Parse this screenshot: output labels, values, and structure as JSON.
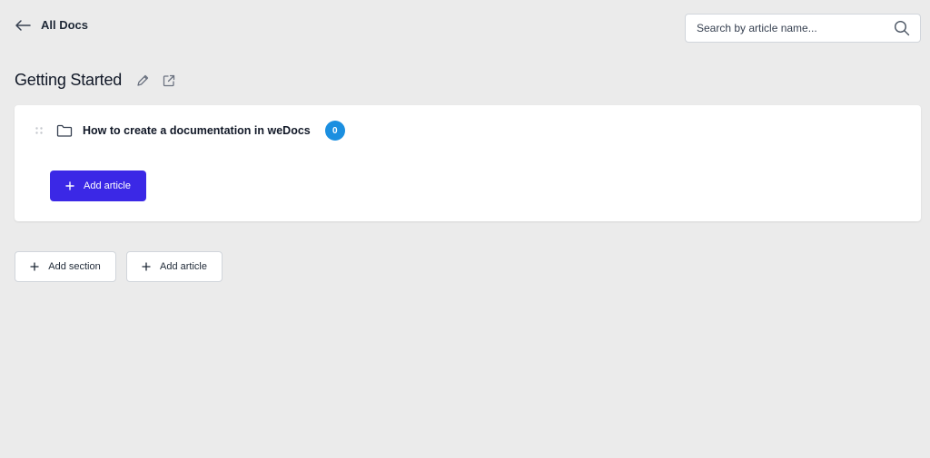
{
  "header": {
    "back_label": "All Docs",
    "back_icon": "arrow-left-icon"
  },
  "search": {
    "placeholder": "Search by article name...",
    "value": "",
    "icon": "search-icon"
  },
  "doc": {
    "title": "Getting Started",
    "edit_icon": "pencil-icon",
    "open_icon": "external-link-icon"
  },
  "sections": [
    {
      "name": "How to create a documentation in weDocs",
      "article_count": "0",
      "add_article_label": "Add article"
    }
  ],
  "actions": {
    "add_section_label": "Add section",
    "add_article_label": "Add article"
  },
  "colors": {
    "background": "#ebebeb",
    "primary_button": "#3b28e6",
    "badge": "#1b8fe0",
    "card": "#ffffff"
  }
}
